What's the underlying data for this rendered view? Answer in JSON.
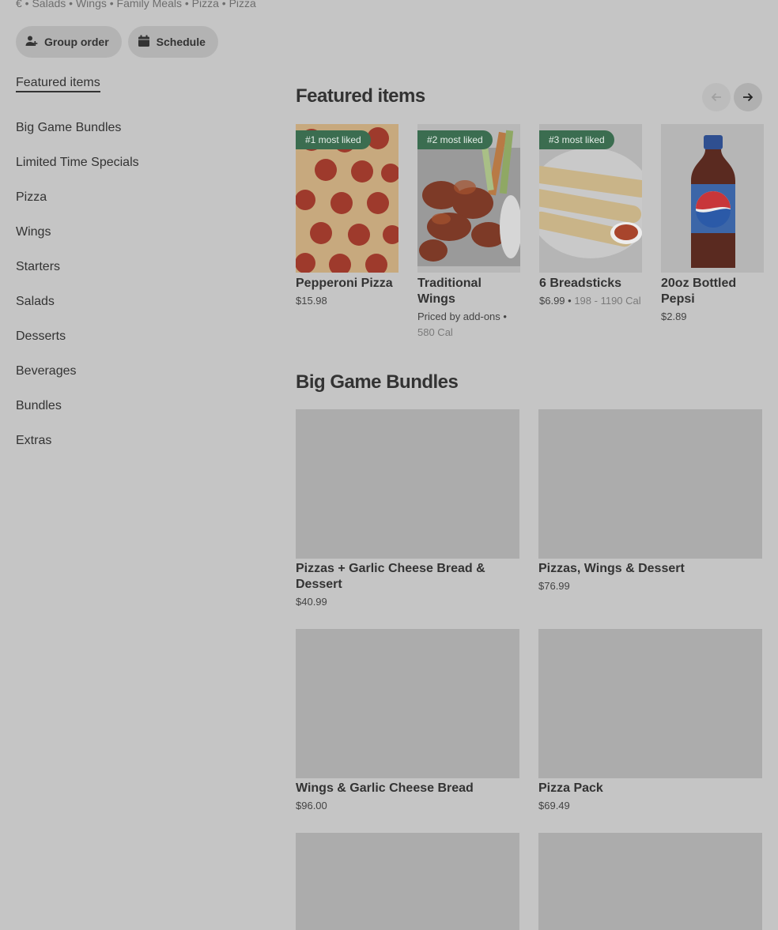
{
  "store": {
    "tagline": "€ • Salads • Wings • Family Meals • Pizza • Pizza"
  },
  "actions": {
    "group_order_label": "Group order",
    "schedule_label": "Schedule"
  },
  "sidenav": {
    "items": [
      {
        "label": "Featured items"
      },
      {
        "label": "Big Game Bundles"
      },
      {
        "label": "Limited Time Specials"
      },
      {
        "label": "Pizza"
      },
      {
        "label": "Wings"
      },
      {
        "label": "Starters"
      },
      {
        "label": "Salads"
      },
      {
        "label": "Desserts"
      },
      {
        "label": "Beverages"
      },
      {
        "label": "Bundles"
      },
      {
        "label": "Extras"
      }
    ]
  },
  "featured": {
    "title": "Featured items",
    "items": [
      {
        "badge": "#1 most liked",
        "name": "Pepperoni Pizza",
        "price": "$15.98",
        "cal": "",
        "image": "pepperoni-pizza"
      },
      {
        "badge": "#2 most liked",
        "name": "Traditional Wings",
        "price": "Priced by add-ons",
        "cal": "580 Cal",
        "image": "wings"
      },
      {
        "badge": "#3 most liked",
        "name": "6 Breadsticks",
        "price": "$6.99",
        "cal": "198 - 1190 Cal",
        "image": "breadsticks"
      },
      {
        "badge": "",
        "name": "20oz Bottled Pepsi",
        "price": "$2.89",
        "cal": "",
        "image": "pepsi-bottle"
      }
    ]
  },
  "bundles": {
    "title": "Big Game Bundles",
    "items": [
      {
        "name": "Pizzas + Garlic Cheese Bread & Dessert",
        "price": "$40.99"
      },
      {
        "name": "Pizzas, Wings & Dessert",
        "price": "$76.99"
      },
      {
        "name": "Wings & Garlic Cheese Bread",
        "price": "$96.00"
      },
      {
        "name": "Pizza Pack",
        "price": "$69.49"
      }
    ]
  },
  "icons": {
    "group_order": "add-person-icon",
    "schedule": "calendar-icon",
    "prev": "arrow-left-icon",
    "next": "arrow-right-icon"
  },
  "colors": {
    "badge_bg": "#3b6d50",
    "overlay_bg": "#c5c5c5"
  }
}
